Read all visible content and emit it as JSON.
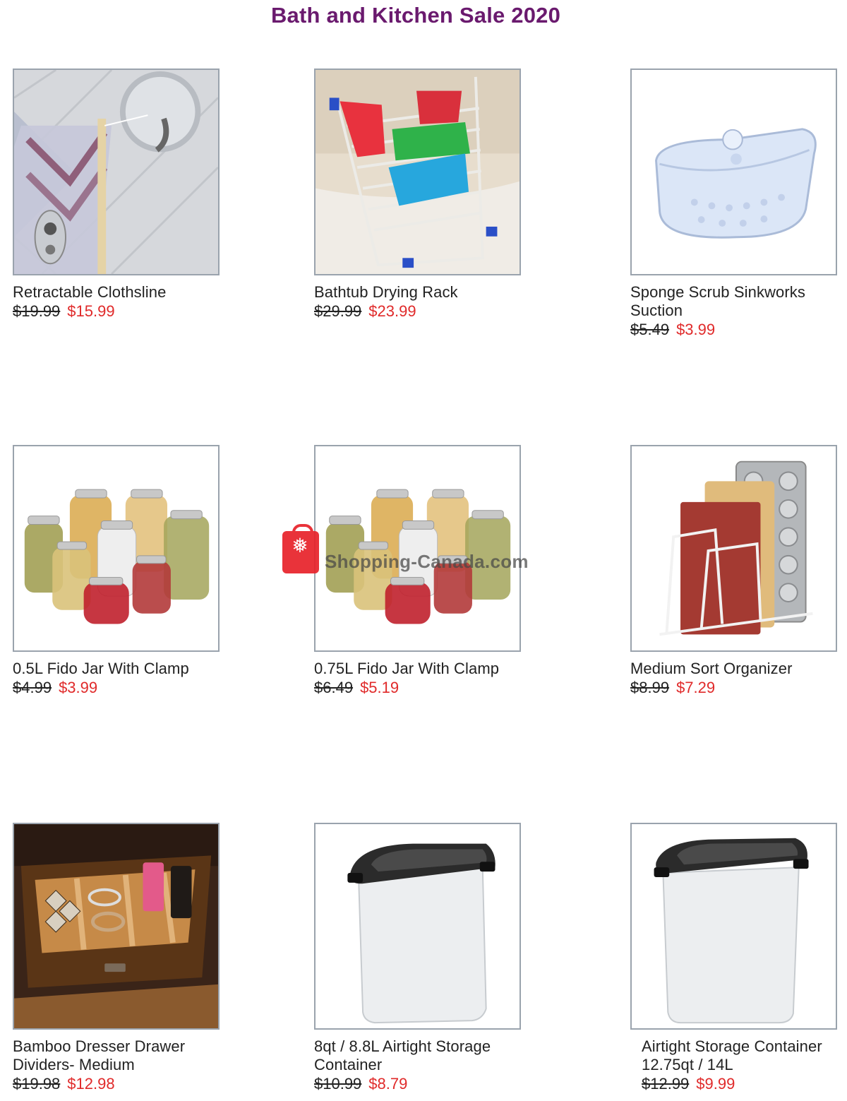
{
  "page": {
    "title": "Bath and Kitchen Sale 2020"
  },
  "watermark": {
    "text": "Shopping-Canada.com",
    "icon": "maple-leaf-shopping-bag-icon",
    "color": "#e8222a"
  },
  "colors": {
    "title": "#6a1a6e",
    "sale_price": "#e02a2a",
    "frame_border": "#9aa3ad"
  },
  "products": [
    {
      "name": "Retractable Clothsline",
      "old_price": "$19.99",
      "new_price": "$15.99",
      "image": "retractable-clothesline-image"
    },
    {
      "name": "Bathtub Drying Rack",
      "old_price": "$29.99",
      "new_price": "$23.99",
      "image": "bathtub-drying-rack-image"
    },
    {
      "name": "Sponge Scrub Sinkworks Suction",
      "old_price": "$5.49",
      "new_price": "$3.99",
      "image": "sponge-caddy-image"
    },
    {
      "name": "0.5L Fido Jar With Clamp",
      "old_price": "$4.99",
      "new_price": "$3.99",
      "image": "fido-jars-image"
    },
    {
      "name": "0.75L Fido Jar With Clamp",
      "old_price": "$6.49",
      "new_price": "$5.19",
      "image": "fido-jars-image"
    },
    {
      "name": "Medium Sort Organizer",
      "old_price": "$8.99",
      "new_price": "$7.29",
      "image": "sort-organizer-image"
    },
    {
      "name": "Bamboo Dresser Drawer Dividers- Medium",
      "old_price": "$19.98",
      "new_price": "$12.98",
      "image": "drawer-dividers-image"
    },
    {
      "name": "8qt / 8.8L Airtight Storage Container",
      "old_price": "$10.99",
      "new_price": "$8.79",
      "image": "storage-container-image"
    },
    {
      "name": "Airtight Storage Container 12.75qt / 14L",
      "old_price": "$12.99",
      "new_price": "$9.99",
      "image": "storage-container-image"
    }
  ]
}
